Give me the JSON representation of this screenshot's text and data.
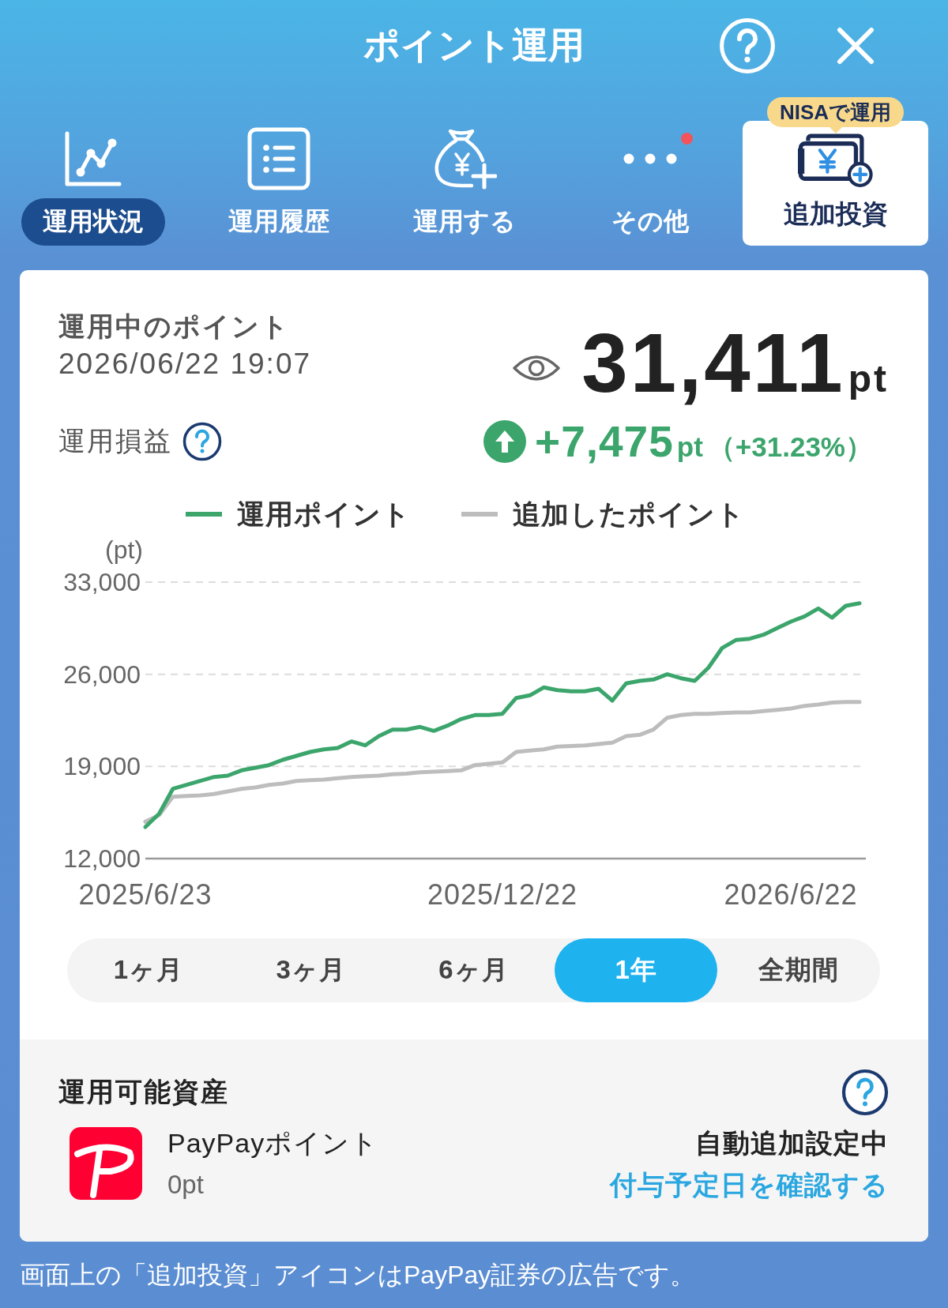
{
  "header": {
    "title": "ポイント運用"
  },
  "nav": {
    "items": [
      {
        "label": "運用状況",
        "selected": true,
        "notification": false
      },
      {
        "label": "運用履歴",
        "selected": false,
        "notification": false
      },
      {
        "label": "運用する",
        "selected": false,
        "notification": false
      },
      {
        "label": "その他",
        "selected": false,
        "notification": true
      }
    ],
    "promo": {
      "badge": "NISAで運用",
      "label": "追加投資"
    }
  },
  "summary": {
    "title": "運用中のポイント",
    "updated_at": "2026/06/22 19:07",
    "total": "31,411",
    "total_unit": "pt",
    "profit": {
      "label": "運用損益",
      "gain": true,
      "amount": "+7,475",
      "unit": "pt",
      "rate": "（+31.23%）"
    }
  },
  "performance": {
    "chart_data": {
      "type": "line",
      "ylabel": "(pt)",
      "categories": [
        "2025/6/23",
        null,
        null,
        null,
        null,
        null,
        null,
        null,
        null,
        null,
        null,
        null,
        null,
        null,
        null,
        null,
        null,
        null,
        null,
        null,
        null,
        null,
        null,
        null,
        null,
        null,
        "2025/12/22",
        null,
        null,
        null,
        null,
        null,
        null,
        null,
        null,
        null,
        null,
        null,
        null,
        null,
        null,
        null,
        null,
        null,
        null,
        null,
        null,
        "2026/6/22",
        null,
        null,
        null,
        null,
        null
      ],
      "ylim": [
        12000,
        33000
      ],
      "yticks": [
        {
          "value": 12000,
          "label": "12,000"
        },
        {
          "value": 19000,
          "label": "19,000"
        },
        {
          "value": 26000,
          "label": "26,000"
        },
        {
          "value": 33000,
          "label": "33,000"
        }
      ],
      "series": [
        {
          "name": "運用ポイント",
          "color": "#3ba56c",
          "values": [
            14400,
            15400,
            17300,
            17600,
            17900,
            18200,
            18300,
            18700,
            18900,
            19100,
            19500,
            19800,
            20100,
            20300,
            20400,
            20900,
            20600,
            21300,
            21800,
            21800,
            22000,
            21700,
            22100,
            22600,
            22900,
            22900,
            23000,
            24200,
            24400,
            25000,
            24800,
            24700,
            24700,
            24900,
            24000,
            25300,
            25500,
            25600,
            26000,
            25700,
            25500,
            26500,
            28000,
            28600,
            28700,
            29000,
            29500,
            30000,
            30400,
            31000,
            30300,
            31200,
            31400
          ]
        },
        {
          "name": "追加したポイント",
          "color": "#bdbdbd",
          "values": [
            14800,
            15300,
            16700,
            16750,
            16800,
            16900,
            17100,
            17300,
            17400,
            17600,
            17700,
            17900,
            17950,
            18000,
            18100,
            18200,
            18250,
            18300,
            18400,
            18450,
            18550,
            18600,
            18650,
            18700,
            19100,
            19200,
            19300,
            20100,
            20200,
            20300,
            20500,
            20550,
            20600,
            20700,
            20800,
            21300,
            21400,
            21800,
            22700,
            22900,
            23000,
            23000,
            23050,
            23100,
            23100,
            23200,
            23300,
            23400,
            23600,
            23700,
            23850,
            23900,
            23900
          ]
        }
      ]
    },
    "periods": [
      {
        "label": "1ヶ月",
        "selected": false
      },
      {
        "label": "3ヶ月",
        "selected": false
      },
      {
        "label": "6ヶ月",
        "selected": false
      },
      {
        "label": "1年",
        "selected": true
      },
      {
        "label": "全期間",
        "selected": false
      }
    ]
  },
  "assets": {
    "title": "運用可能資産",
    "name": "PayPayポイント",
    "balance": "0pt",
    "auto_status": "自動追加設定中",
    "link": "付与予定日を確認する"
  },
  "footer": {
    "note": "画面上の「追加投資」アイコンはPayPay証券の広告です。"
  }
}
